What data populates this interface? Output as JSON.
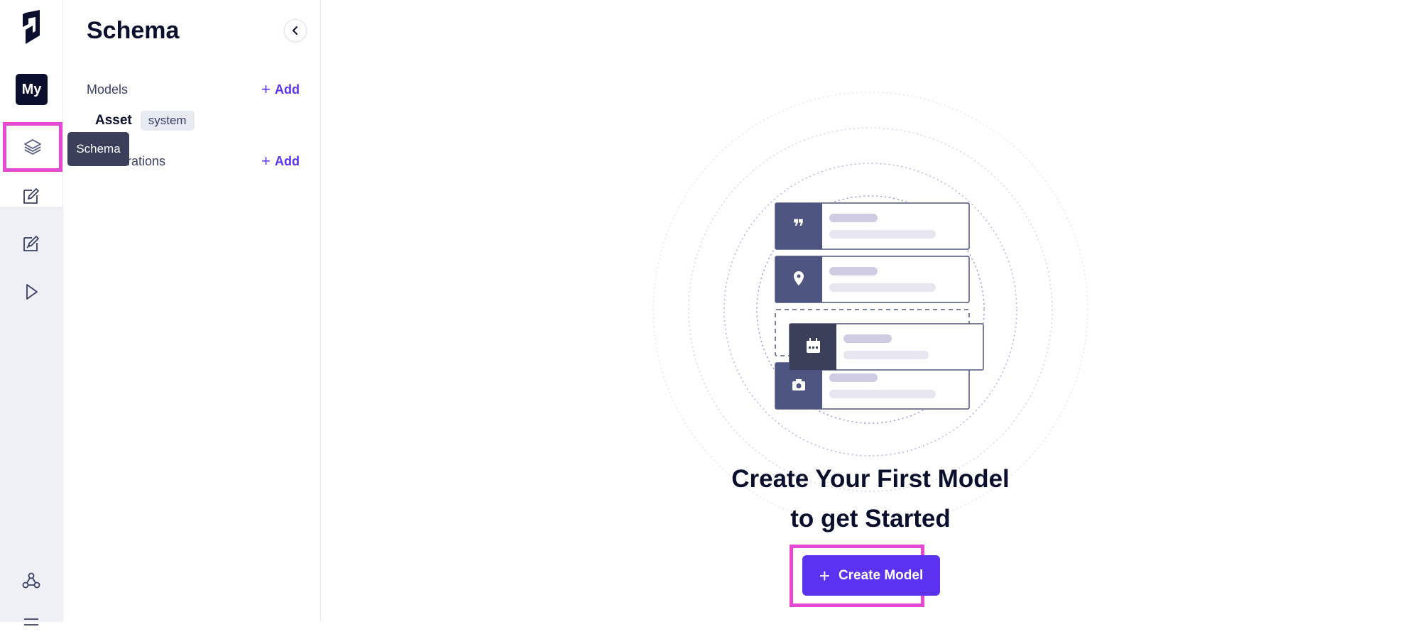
{
  "rail": {
    "project_initials": "My",
    "items": [
      {
        "name": "schema",
        "icon": "layers-icon"
      },
      {
        "name": "content",
        "icon": "edit-icon"
      },
      {
        "name": "content-alt",
        "icon": "edit-icon"
      },
      {
        "name": "playground",
        "icon": "play-icon"
      },
      {
        "name": "webhooks",
        "icon": "webhook-icon"
      }
    ],
    "tooltip": "Schema"
  },
  "sidebar": {
    "title": "Schema",
    "sections": [
      {
        "label": "Models",
        "add_label": "Add"
      },
      {
        "label": "Enumerations",
        "add_label": "Add"
      }
    ],
    "models": [
      {
        "name": "Asset",
        "badge": "system"
      }
    ]
  },
  "main": {
    "headline_line1": "Create Your First Model",
    "headline_line2": "to get Started",
    "cta_label": "Create Model"
  },
  "colors": {
    "accent": "#5a32f0",
    "highlight": "#e548d3",
    "dark": "#0b0f2e",
    "illustration_slate": "#4e5580"
  }
}
